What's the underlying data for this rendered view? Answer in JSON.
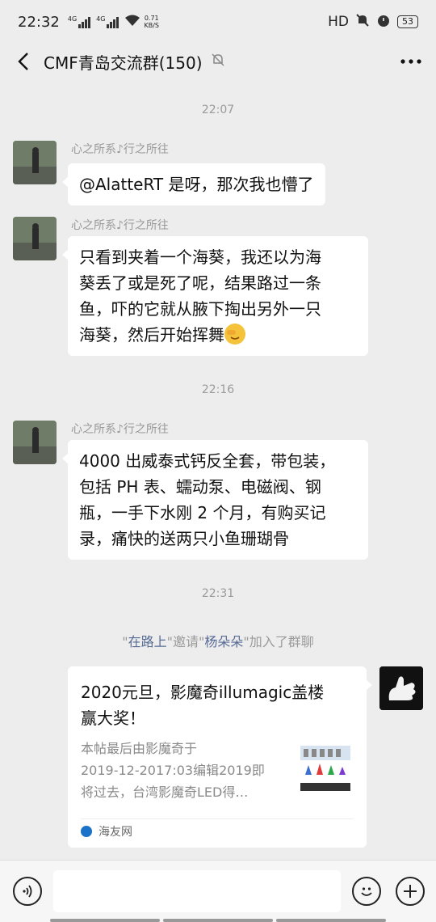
{
  "status_bar": {
    "time": "22:32",
    "sim1": "4G",
    "sim2": "4G",
    "net_speed": "0.71",
    "net_unit": "KB/S",
    "hd": "HD",
    "battery": "53"
  },
  "header": {
    "title": "CMF青岛交流群(150)"
  },
  "chat": {
    "timestamps": [
      "22:07",
      "22:16",
      "22:31"
    ],
    "messages": [
      {
        "sender": "心之所系♪行之所往",
        "text": "@AlatteRT  是呀，那次我也懵了"
      },
      {
        "sender": "心之所系♪行之所往",
        "lines": [
          "只看到夹着一个海葵，我还以为海",
          "葵丢了或是死了呢，结果路过一条",
          "鱼，吓的它就从腋下掏出另外一只",
          "海葵，然后开始挥舞"
        ],
        "emoji": "facepalm-emoji"
      },
      {
        "sender": "心之所系♪行之所往",
        "lines": [
          "4000 出威泰式钙反全套，带包装，",
          "包括 PH 表、蠕动泵、电磁阀、钢",
          "瓶，一手下水刚 2 个月，有购买记",
          "录，痛快的送两只小鱼珊瑚骨"
        ]
      }
    ],
    "system": {
      "q1": "\"",
      "inviter": "在路上",
      "mid": "\"邀请\"",
      "invitee": "杨朵朵",
      "tail": "\"加入了群聊"
    },
    "card": {
      "title_lines": [
        "2020元旦，影魔奇illumagic盖楼",
        "赢大奖！"
      ],
      "desc_lines": [
        "本帖最后由影魔奇于",
        "2019-12-2017:03编辑2019即",
        "将过去，台湾影魔奇LED得…"
      ],
      "source": "海友网"
    }
  },
  "input_bar": {
    "placeholder": ""
  }
}
